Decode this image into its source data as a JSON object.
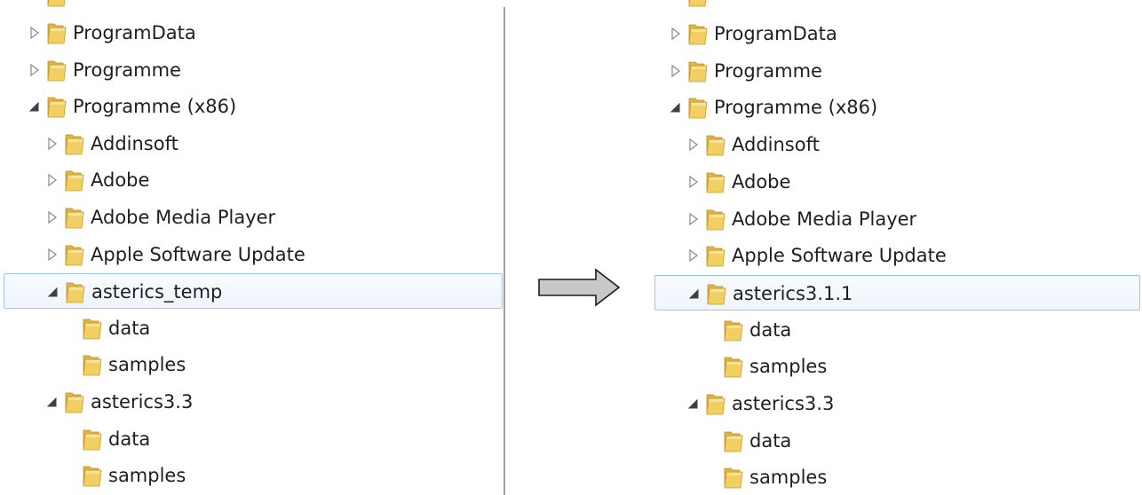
{
  "left_tree": {
    "items": [
      {
        "label": "ProgramData",
        "level": 0,
        "expander": "collapsed"
      },
      {
        "label": "Programme",
        "level": 0,
        "expander": "collapsed"
      },
      {
        "label": "Programme (x86)",
        "level": 0,
        "expander": "expanded"
      },
      {
        "label": "Addinsoft",
        "level": 1,
        "expander": "collapsed"
      },
      {
        "label": "Adobe",
        "level": 1,
        "expander": "collapsed"
      },
      {
        "label": "Adobe Media Player",
        "level": 1,
        "expander": "collapsed"
      },
      {
        "label": "Apple Software Update",
        "level": 1,
        "expander": "collapsed"
      },
      {
        "label": "asterics_temp",
        "level": 1,
        "expander": "expanded",
        "selected": true
      },
      {
        "label": "data",
        "level": 2,
        "expander": "none"
      },
      {
        "label": "samples",
        "level": 2,
        "expander": "none"
      },
      {
        "label": "asterics3.3",
        "level": 1,
        "expander": "expanded"
      },
      {
        "label": "data",
        "level": 2,
        "expander": "none"
      },
      {
        "label": "samples",
        "level": 2,
        "expander": "none"
      }
    ]
  },
  "right_tree": {
    "items": [
      {
        "label": "ProgramData",
        "level": 0,
        "expander": "collapsed"
      },
      {
        "label": "Programme",
        "level": 0,
        "expander": "collapsed"
      },
      {
        "label": "Programme (x86)",
        "level": 0,
        "expander": "expanded"
      },
      {
        "label": "Addinsoft",
        "level": 1,
        "expander": "collapsed"
      },
      {
        "label": "Adobe",
        "level": 1,
        "expander": "collapsed"
      },
      {
        "label": "Adobe Media Player",
        "level": 1,
        "expander": "collapsed"
      },
      {
        "label": "Apple Software Update",
        "level": 1,
        "expander": "collapsed"
      },
      {
        "label": "asterics3.1.1",
        "level": 1,
        "expander": "expanded",
        "selected": true
      },
      {
        "label": "data",
        "level": 2,
        "expander": "none"
      },
      {
        "label": "samples",
        "level": 2,
        "expander": "none"
      },
      {
        "label": "asterics3.3",
        "level": 1,
        "expander": "expanded"
      },
      {
        "label": "data",
        "level": 2,
        "expander": "none"
      },
      {
        "label": "samples",
        "level": 2,
        "expander": "none"
      }
    ]
  },
  "arrow_icon": "right-arrow-icon",
  "folder_icon": "folder-icon",
  "colors": {
    "selection_border": "#9fc6ea",
    "folder_yellow": "#f2cf63",
    "arrow_fill": "#c8c8c8",
    "divider": "#a0a0a0"
  }
}
